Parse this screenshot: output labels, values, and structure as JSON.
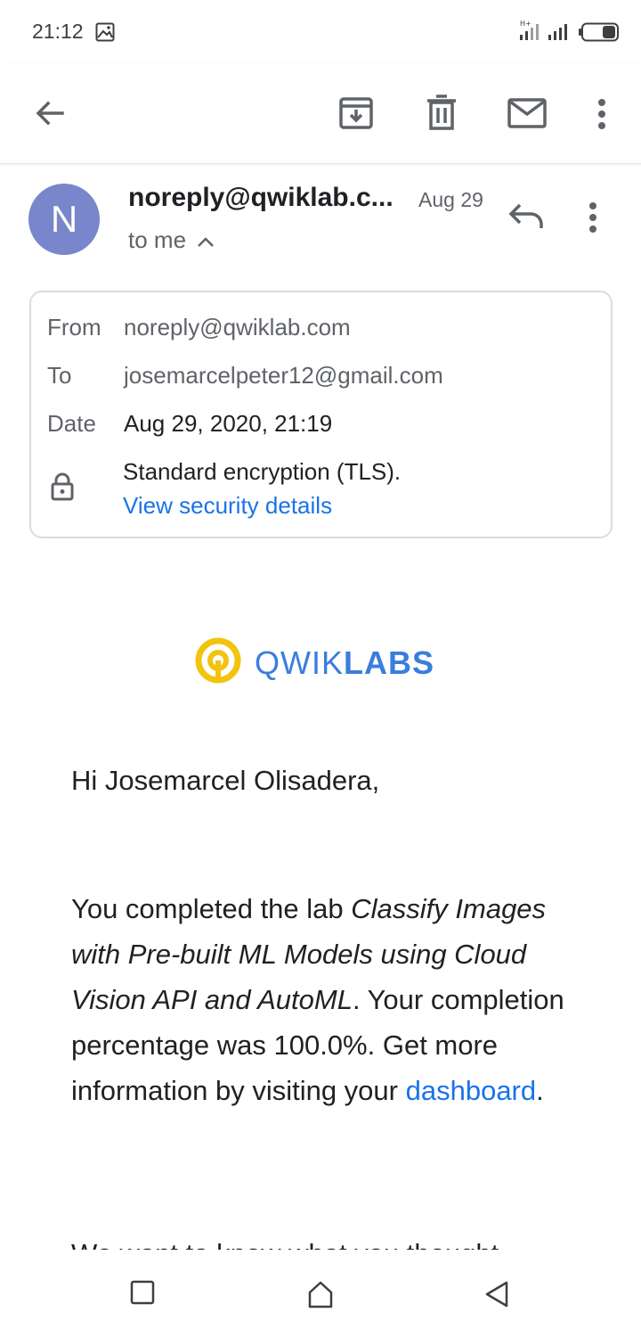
{
  "status_bar": {
    "time": "21:12",
    "icons": [
      "image-icon",
      "signal-h-plus-icon",
      "signal-icon",
      "battery-icon"
    ]
  },
  "app_bar": {
    "icons": [
      "back-arrow-icon",
      "archive-icon",
      "delete-icon",
      "mark-unread-icon",
      "more-vert-icon"
    ]
  },
  "message": {
    "avatar_letter": "N",
    "avatar_color": "#7986cb",
    "sender": "noreply@qwiklab.c...",
    "date_short": "Aug 29",
    "recipient_summary": "to me"
  },
  "details": {
    "from_label": "From",
    "from_value": "noreply@qwiklab.com",
    "to_label": "To",
    "to_value": "josemarcelpeter12@gmail.com",
    "date_label": "Date",
    "date_value": "Aug 29, 2020, 21:19",
    "encryption": "Standard encryption (TLS).",
    "security_link": "View security details"
  },
  "logo": {
    "text_light": "QWIK",
    "text_bold": "LABS",
    "brand_color": "#3b7ddd",
    "mark_color": "#f2c40f"
  },
  "body": {
    "greeting": "Hi Josemarcel Olisadera,",
    "p1_before": "You completed the lab ",
    "p1_lab": "Classify Images with Pre-built ML Models using Cloud Vision API and AutoML",
    "p1_after": ". Your completion percentage was 100.0%. Get more information by visiting your ",
    "p1_link": "dashboard",
    "p1_end": ".",
    "cut_line": "We want to know what you thought"
  },
  "nav_bar": {
    "icons": [
      "recents-square-icon",
      "home-icon",
      "back-triangle-icon"
    ]
  },
  "colors": {
    "link": "#1a73e8",
    "text_primary": "#202124",
    "text_secondary": "#5f6368"
  }
}
